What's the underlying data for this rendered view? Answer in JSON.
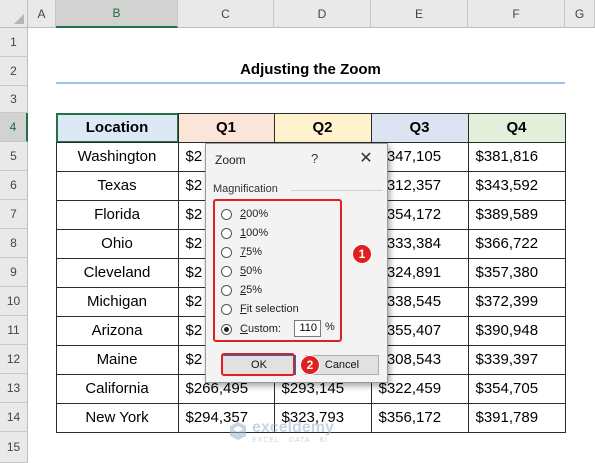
{
  "columns": [
    "A",
    "B",
    "C",
    "D",
    "E",
    "F",
    "G"
  ],
  "rows": [
    "1",
    "2",
    "3",
    "4",
    "5",
    "6",
    "7",
    "8",
    "9",
    "10",
    "11",
    "12",
    "13",
    "14",
    "15"
  ],
  "title": "Adjusting the Zoom",
  "table": {
    "headers": [
      "Location",
      "Q1",
      "Q2",
      "Q3",
      "Q4"
    ],
    "header_colors": [
      "#dde8f6",
      "#fbe5d9",
      "#fff2cc",
      "#dce4f2",
      "#e2efda"
    ],
    "rows": [
      {
        "location": "Washington",
        "q1": "$2",
        "q2": "",
        "q3": "$347,105",
        "q4": "$381,816"
      },
      {
        "location": "Texas",
        "q1": "$2",
        "q2": "",
        "q3": "$312,357",
        "q4": "$343,592"
      },
      {
        "location": "Florida",
        "q1": "$2",
        "q2": "",
        "q3": "$354,172",
        "q4": "$389,589"
      },
      {
        "location": "Ohio",
        "q1": "$2",
        "q2": "",
        "q3": "$333,384",
        "q4": "$366,722"
      },
      {
        "location": "Cleveland",
        "q1": "$2",
        "q2": "",
        "q3": "$324,891",
        "q4": "$357,380"
      },
      {
        "location": "Michigan",
        "q1": "$2",
        "q2": "",
        "q3": "$338,545",
        "q4": "$372,399"
      },
      {
        "location": "Arizona",
        "q1": "$2",
        "q2": "",
        "q3": "$355,407",
        "q4": "$390,948"
      },
      {
        "location": "Maine",
        "q1": "$2",
        "q2": "",
        "q3": "$308,543",
        "q4": "$339,397"
      },
      {
        "location": "California",
        "q1": "$266,495",
        "q2": "$293,145",
        "q3": "$322,459",
        "q4": "$354,705"
      },
      {
        "location": "New York",
        "q1": "$294,357",
        "q2": "$323,793",
        "q3": "$356,172",
        "q4": "$391,789"
      }
    ]
  },
  "dialog": {
    "title": "Zoom",
    "help": "?",
    "close": "✕",
    "group_label": "Magnification",
    "options": [
      {
        "label": "200%",
        "selected": false
      },
      {
        "label": "100%",
        "selected": false
      },
      {
        "label": "75%",
        "selected": false
      },
      {
        "label": "50%",
        "selected": false
      },
      {
        "label": "25%",
        "selected": false
      },
      {
        "label": "Fit selection",
        "selected": false
      },
      {
        "label": "Custom:",
        "selected": true
      }
    ],
    "custom_value": "110",
    "percent_sign": "%",
    "ok_label": "OK",
    "cancel_label": "Cancel"
  },
  "callouts": {
    "badge1": "1",
    "badge2": "2",
    "highlight_color": "#e02020"
  },
  "watermark": {
    "name": "exceldemy",
    "tagline": "EXCEL · DATA · BI"
  }
}
